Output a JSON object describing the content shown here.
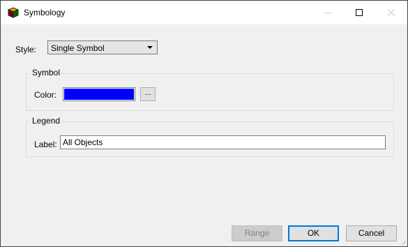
{
  "window": {
    "title": "Symbology",
    "icon": "rubiks-cube-icon"
  },
  "style": {
    "label": "Style:",
    "selected": "Single Symbol"
  },
  "symbol_group": {
    "title": "Symbol",
    "color_label": "Color:",
    "color_value": "#0000ff",
    "picker_label": "..."
  },
  "legend_group": {
    "title": "Legend",
    "label_label": "Label:",
    "label_value": "All Objects"
  },
  "buttons": {
    "range": "Range",
    "ok": "OK",
    "cancel": "Cancel"
  }
}
